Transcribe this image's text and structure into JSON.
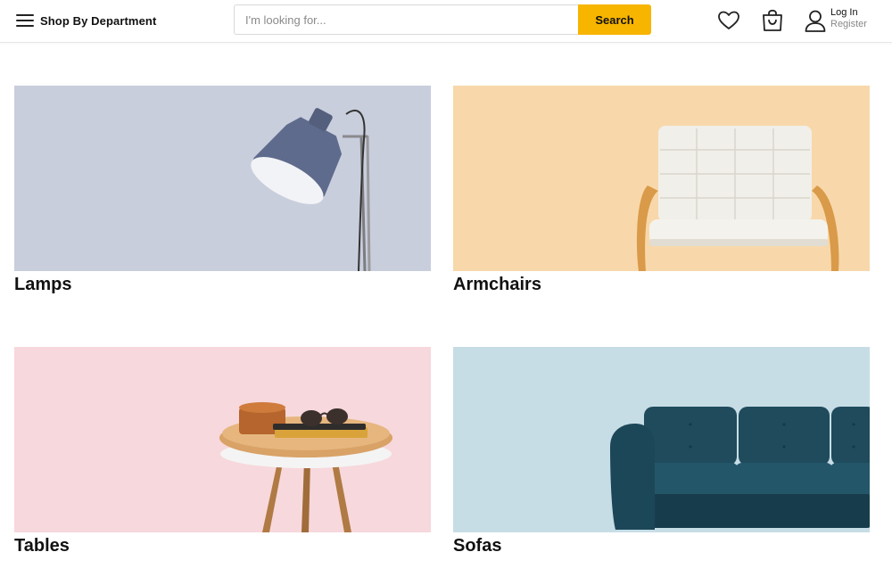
{
  "header": {
    "department_label": "Shop By Department",
    "search": {
      "placeholder": "I'm looking for...",
      "value": "",
      "button_label": "Search"
    },
    "account": {
      "login_label": "Log In",
      "register_label": "Register"
    },
    "icons": [
      "menu-icon",
      "heart-icon",
      "shopping-bag-icon",
      "user-icon"
    ]
  },
  "colors": {
    "accent": "#f7b500",
    "lamps_bg": "#c9cedd",
    "armchairs_bg": "#f8d8aa",
    "tables_bg": "#f7d8dc",
    "sofas_bg": "#c7dde6"
  },
  "categories": [
    {
      "label": "Lamps"
    },
    {
      "label": "Armchairs"
    },
    {
      "label": "Tables"
    },
    {
      "label": "Sofas"
    }
  ]
}
